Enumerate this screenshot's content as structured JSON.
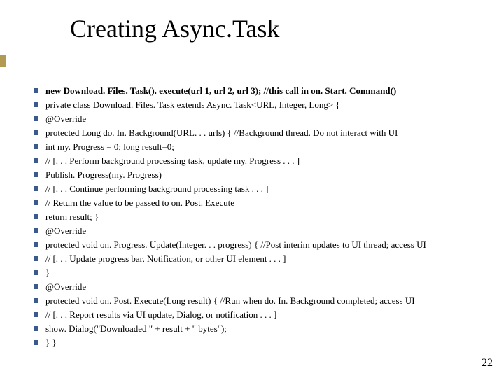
{
  "title": "Creating Async.Task",
  "page_number": "22",
  "lines": [
    {
      "bold": true,
      "text": "new Download. Files. Task(). execute(url 1, url 2, url 3); //this call in on. Start. Command()"
    },
    {
      "bold": false,
      "text": "private class Download. Files. Task extends Async. Task<URL, Integer, Long> {"
    },
    {
      "bold": false,
      "text": "@Override"
    },
    {
      "bold": false,
      "text": "protected Long do. In. Background(URL. . . urls) { //Background thread. Do not interact with UI"
    },
    {
      "bold": false,
      "text": "int my. Progress = 0; long result=0;"
    },
    {
      "bold": false,
      "text": "// [. . . Perform background processing task, update my. Progress . . . ]"
    },
    {
      "bold": false,
      "text": "Publish. Progress(my. Progress)"
    },
    {
      "bold": false,
      "text": "// [. . . Continue performing background processing task . . . ]"
    },
    {
      "bold": false,
      "text": "// Return the value to be passed to on. Post. Execute"
    },
    {
      "bold": false,
      "text": "return result; }"
    },
    {
      "bold": false,
      "text": "@Override"
    },
    {
      "bold": false,
      "text": "protected void on. Progress. Update(Integer. . . progress) { //Post interim updates to UI thread; access UI"
    },
    {
      "bold": false,
      "text": "// [. . . Update progress bar, Notification, or other UI element . . . ]"
    },
    {
      "bold": false,
      "text": "}"
    },
    {
      "bold": false,
      "text": "@Override"
    },
    {
      "bold": false,
      "text": "protected void on. Post. Execute(Long result) { //Run when do. In. Background completed; access UI"
    },
    {
      "bold": false,
      "text": "// [. . . Report results via UI update, Dialog, or notification . . . ]"
    },
    {
      "bold": false,
      "text": "show. Dialog(\"Downloaded \" + result + \" bytes\");"
    },
    {
      "bold": false,
      "text": "}   }"
    }
  ]
}
